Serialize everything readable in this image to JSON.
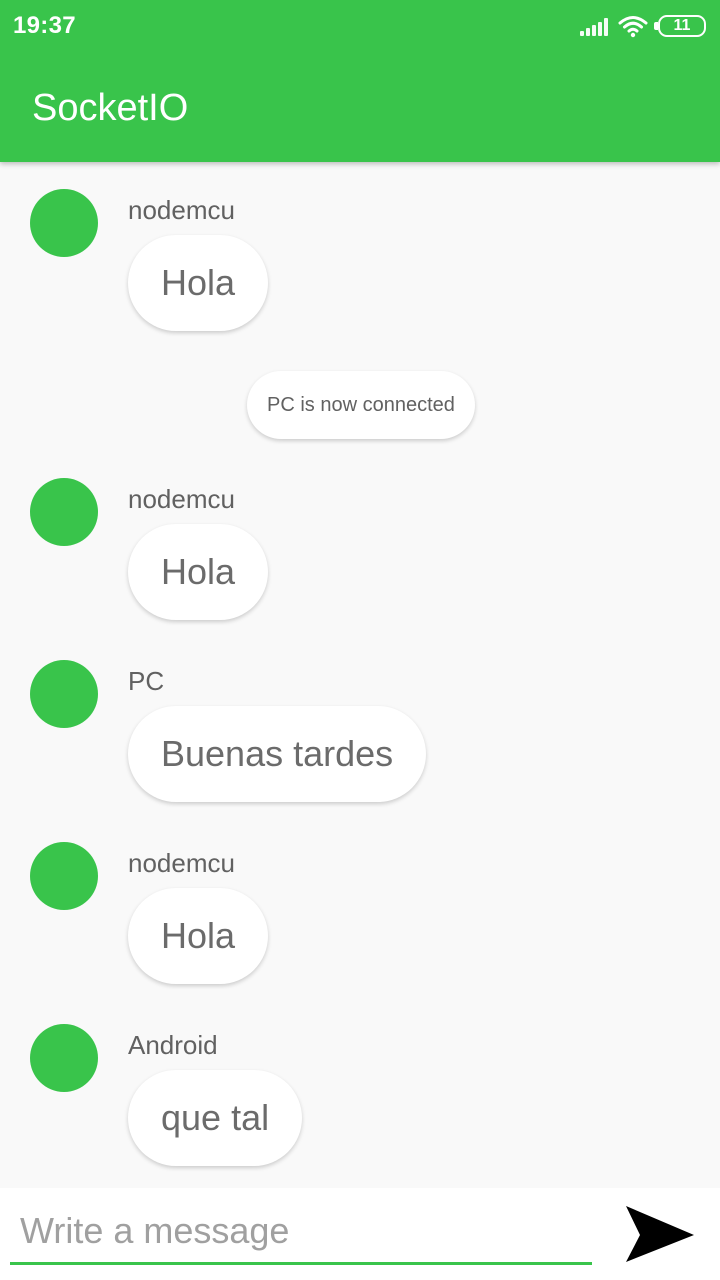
{
  "status_bar": {
    "time": "19:37",
    "battery": "11"
  },
  "app_bar": {
    "title": "SocketIO"
  },
  "messages": [
    {
      "sender": "nodemcu",
      "text": "Hola"
    },
    {
      "system": "PC is now connected"
    },
    {
      "sender": "nodemcu",
      "text": "Hola"
    },
    {
      "sender": "PC",
      "text": "Buenas tardes"
    },
    {
      "sender": "nodemcu",
      "text": "Hola"
    },
    {
      "sender": "Android",
      "text": "que tal"
    }
  ],
  "composer": {
    "placeholder": "Write a message",
    "value": ""
  },
  "colors": {
    "accent": "#39c44b",
    "background": "#f9f9f9",
    "bubble": "#ffffff"
  },
  "icons": {
    "send": "send-icon",
    "wifi": "wifi-icon",
    "signal": "signal-icon",
    "battery": "battery-icon"
  }
}
